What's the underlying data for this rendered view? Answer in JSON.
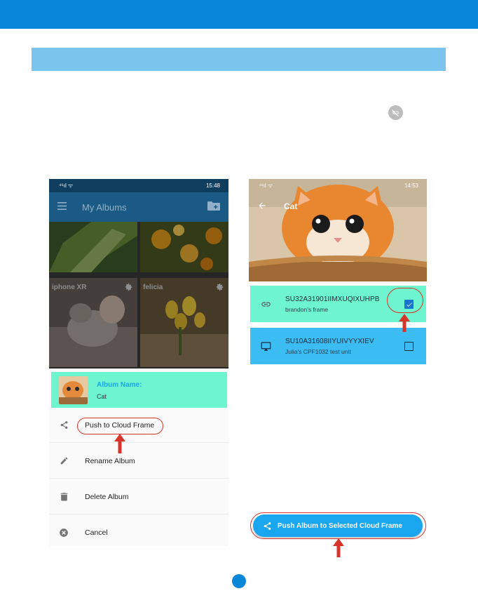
{
  "colors": {
    "header_blue": "#0a86d8",
    "section_blue": "#7bc4ee",
    "card_green": "#6ef5cf",
    "card_blue": "#3bbcf3",
    "accent_red": "#d9342b"
  },
  "left_phone": {
    "status": {
      "left": "⁴⁶ıl ᯤ",
      "time": "15:48"
    },
    "appbar": {
      "title": "My Albums",
      "menu_icon": "menu-icon",
      "action_icon": "add-folder-icon"
    },
    "tiles": [
      {
        "label": ""
      },
      {
        "label": ""
      },
      {
        "label": "iphone XR"
      },
      {
        "label": "felicia"
      }
    ],
    "sheet": {
      "album_name_label": "Album Name:",
      "album_name_value": "Cat",
      "items": [
        {
          "label": "Push to Cloud Frame",
          "icon": "share-icon"
        },
        {
          "label": "Rename Album",
          "icon": "pencil-icon"
        },
        {
          "label": "Delete Album",
          "icon": "trash-icon"
        },
        {
          "label": "Cancel",
          "icon": "cancel-circle-icon"
        }
      ]
    }
  },
  "right_phone": {
    "status": {
      "left": "⁴⁶ıl ᯤ",
      "time": "14:53"
    },
    "title": "Cat",
    "devices": [
      {
        "id": "SU32A31901IIMXUQIXUHPB",
        "name": "brandon's frame",
        "icon": "link-icon",
        "checked": true
      },
      {
        "id": "SU10A31608IIYUIVYYXIEV",
        "name": "Julia's CPF1032 test unit",
        "icon": "monitor-icon",
        "checked": false
      }
    ],
    "push_button": "Push Album to Selected Cloud Frame"
  }
}
